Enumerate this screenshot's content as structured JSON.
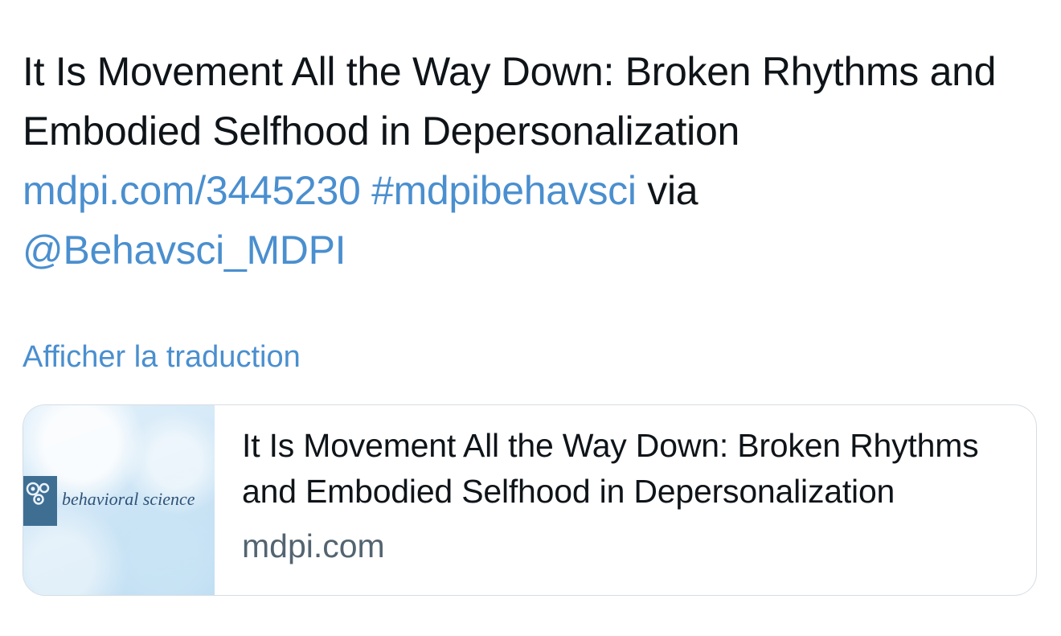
{
  "tweet": {
    "title_text": "It Is Movement All the Way Down: Broken Rhythms and Embodied Selfhood in Depersonalization",
    "link_text": "mdpi.com/3445230",
    "hashtag": "#mdpibehavsci",
    "via_text": "via",
    "mention": "@Behavsci_MDPI"
  },
  "translate_label": "Afficher la traduction",
  "link_card": {
    "image_caption": "behavioral science",
    "title": "It Is Movement All the Way Down: Broken Rhythms and Embodied Selfhood in Depersonalization",
    "domain": "mdpi.com",
    "image_icon": "head-gears-icon"
  },
  "colors": {
    "link": "#4a8fcf",
    "text": "#0f1419",
    "muted": "#536471",
    "border": "#d6dde2"
  }
}
